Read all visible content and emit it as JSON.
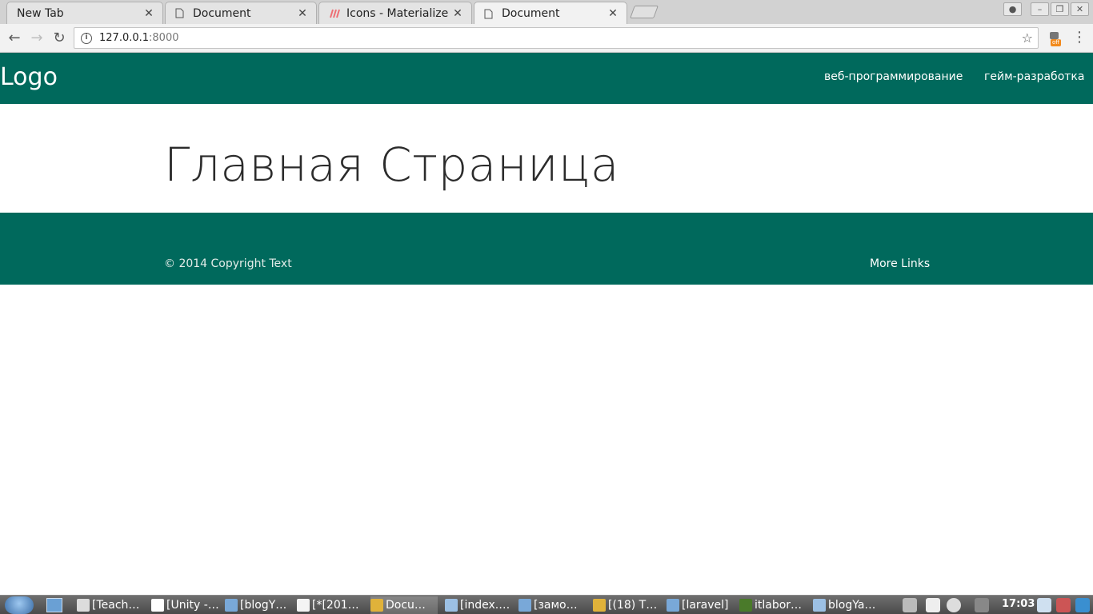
{
  "browser": {
    "tabs": [
      {
        "title": "New Tab",
        "favicon": "none"
      },
      {
        "title": "Document",
        "favicon": "page-icon"
      },
      {
        "title": "Icons - Materialize",
        "favicon": "materialize-icon"
      },
      {
        "title": "Document",
        "favicon": "page-icon",
        "active": true
      }
    ],
    "address": {
      "host": "127.0.0.1",
      "port": ":8000"
    },
    "extension_badge": "off"
  },
  "page": {
    "logo": "Logo",
    "nav_links": [
      "веб-программирование",
      "гейм-разработка"
    ],
    "heading": "Главная Страница",
    "footer_copyright": "© 2014 Copyright Text",
    "footer_link": "More Links",
    "colors": {
      "primary": "#00695c",
      "heading": "#2b2b2b"
    }
  },
  "taskbar": {
    "items": [
      {
        "label": "[Teach…",
        "icon": "pidgin-icon",
        "icon_color": "#dcdcdc"
      },
      {
        "label": "[Unity -…",
        "icon": "unity-icon",
        "icon_color": "#ffffff"
      },
      {
        "label": "[blogY…",
        "icon": "folder-icon",
        "icon_color": "#79a8d8"
      },
      {
        "label": "[*[201…",
        "icon": "text-editor-icon",
        "icon_color": "#f4f4f4"
      },
      {
        "label": "Docu…",
        "icon": "chrome-icon",
        "icon_color": "#e0b23a",
        "active": true
      },
      {
        "label": "[index.…",
        "icon": "window-icon",
        "icon_color": "#9cc0e4"
      },
      {
        "label": "[замо…",
        "icon": "folder-icon",
        "icon_color": "#79a8d8"
      },
      {
        "label": "[(18) T…",
        "icon": "chrome-icon",
        "icon_color": "#e0b23a"
      },
      {
        "label": "[laravel]",
        "icon": "folder-icon",
        "icon_color": "#79a8d8"
      },
      {
        "label": "itlabor…",
        "icon": "terminal-icon",
        "icon_color": "#4a7a2a"
      },
      {
        "label": "blogYa…",
        "icon": "window-icon",
        "icon_color": "#9cc0e4"
      }
    ],
    "clock": "17:03"
  }
}
